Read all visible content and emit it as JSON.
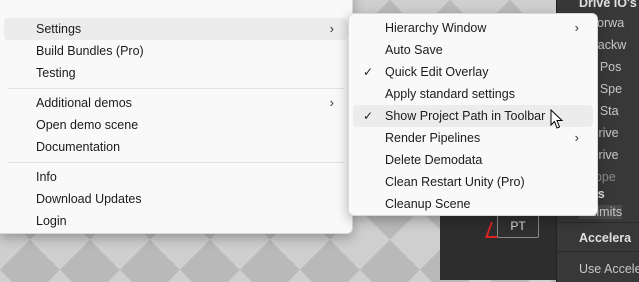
{
  "right_panel": {
    "lines": [
      "Drive IO's",
      "e Forwa",
      "e Backw",
      "get Pos",
      "get Spe",
      "get Sta",
      "p Drive",
      "p Drive",
      "t Uppe",
      "mits",
      "e Limits",
      "Accelera",
      "Use Accele"
    ]
  },
  "scene": {
    "pt_label": "PT"
  },
  "main_menu": {
    "items": [
      {
        "label": "Settings",
        "has_submenu": true,
        "highlighted": true
      },
      {
        "label": "Build Bundles (Pro)"
      },
      {
        "label": "Testing"
      },
      {
        "label": "Additional demos",
        "has_submenu": true
      },
      {
        "label": "Open demo scene"
      },
      {
        "label": "Documentation"
      },
      {
        "label": "Info"
      },
      {
        "label": "Download Updates"
      },
      {
        "label": "Login"
      }
    ]
  },
  "sub_menu": {
    "items": [
      {
        "label": "Hierarchy Window",
        "has_submenu": true
      },
      {
        "label": "Auto Save"
      },
      {
        "label": "Quick Edit Overlay",
        "checked": true
      },
      {
        "label": "Apply standard settings"
      },
      {
        "label": "Show Project Path in Toolbar",
        "checked": true,
        "highlighted": true
      },
      {
        "label": "Render Pipelines",
        "has_submenu": true
      },
      {
        "label": "Delete Demodata"
      },
      {
        "label": "Clean Restart Unity (Pro)"
      },
      {
        "label": "Cleanup Scene"
      }
    ]
  },
  "glyphs": {
    "chevron": "›",
    "check": "✓"
  }
}
